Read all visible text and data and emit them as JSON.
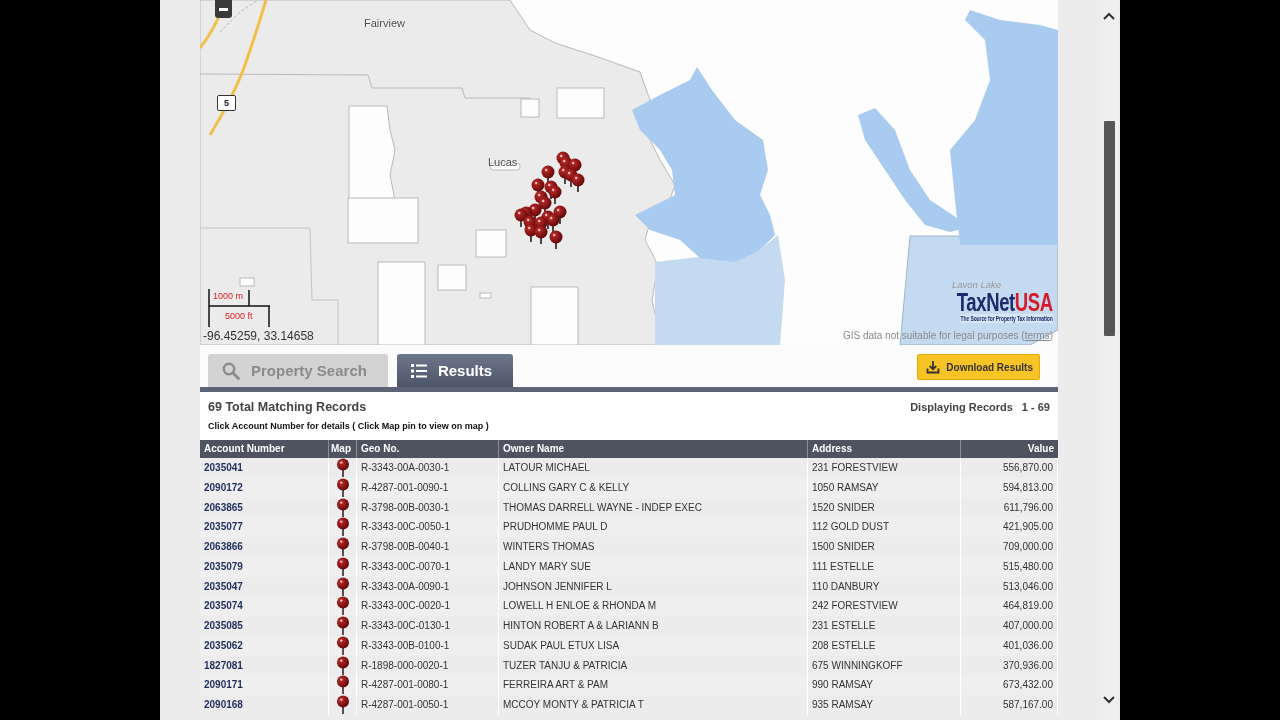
{
  "map": {
    "places": [
      {
        "name": "Fairview"
      },
      {
        "name": "Lucas"
      }
    ],
    "route_shield": "5",
    "lake_label": "Lavon Lake",
    "scale": {
      "metric": "1000 m",
      "imperial": "5000 ft"
    },
    "coordinates": "-96.45259, 33.14658",
    "logo": {
      "wordmark": [
        "TaxNet",
        "USA"
      ],
      "tagline": "The Source for Property Tax Information"
    },
    "disclaimer": {
      "text": "GIS data not suitable for legal purposes (",
      "link": "terms",
      "suffix": ")"
    }
  },
  "tabs": [
    {
      "label": "Property Search",
      "selected": false
    },
    {
      "label": "Results",
      "selected": true
    }
  ],
  "download_button": {
    "label": "Download Results"
  },
  "summary": {
    "total": "69 Total Matching Records",
    "displaying_label": "Displaying Records",
    "range": "1 - 69",
    "hint": "Click Account Number for details ( Click Map pin to view on map )"
  },
  "table": {
    "columns": [
      "Account Number",
      "Map",
      "Geo No.",
      "Owner Name",
      "Address",
      "Value"
    ],
    "rows": [
      {
        "account": "2035041",
        "geo_no": "R-3343-00A-0030-1",
        "owner": "LATOUR MICHAEL",
        "address": "231 FORESTVIEW",
        "value": "556,870.00"
      },
      {
        "account": "2090172",
        "geo_no": "R-4287-001-0090-1",
        "owner": "COLLINS GARY C & KELLY",
        "address": "1050 RAMSAY",
        "value": "594,813.00"
      },
      {
        "account": "2063865",
        "geo_no": "R-3798-00B-0030-1",
        "owner": "THOMAS DARRELL WAYNE - INDEP EXEC",
        "address": "1520 SNIDER",
        "value": "611,796.00"
      },
      {
        "account": "2035077",
        "geo_no": "R-3343-00C-0050-1",
        "owner": "PRUDHOMME PAUL D",
        "address": "112 GOLD DUST",
        "value": "421,905.00"
      },
      {
        "account": "2063866",
        "geo_no": "R-3798-00B-0040-1",
        "owner": "WINTERS THOMAS",
        "address": "1500 SNIDER",
        "value": "709,000.00"
      },
      {
        "account": "2035079",
        "geo_no": "R-3343-00C-0070-1",
        "owner": "LANDY MARY SUE",
        "address": "111 ESTELLE",
        "value": "515,480.00"
      },
      {
        "account": "2035047",
        "geo_no": "R-3343-00A-0090-1",
        "owner": "JOHNSON JENNIFER L",
        "address": "110 DANBURY",
        "value": "513,046.00"
      },
      {
        "account": "2035074",
        "geo_no": "R-3343-00C-0020-1",
        "owner": "LOWELL H ENLOE & RHONDA M",
        "address": "242 FORESTVIEW",
        "value": "464,819.00"
      },
      {
        "account": "2035085",
        "geo_no": "R-3343-00C-0130-1",
        "owner": "HINTON ROBERT A & LARIANN B",
        "address": "231 ESTELLE",
        "value": "407,000.00"
      },
      {
        "account": "2035062",
        "geo_no": "R-3343-00B-0100-1",
        "owner": "SUDAK PAUL ETUX LISA",
        "address": "208 ESTELLE",
        "value": "401,036.00"
      },
      {
        "account": "1827081",
        "geo_no": "R-1898-000-0020-1",
        "owner": "TUZER TANJU & PATRICIA",
        "address": "675 WINNINGKOFF",
        "value": "370,936.00"
      },
      {
        "account": "2090171",
        "geo_no": "R-4287-001-0080-1",
        "owner": "FERREIRA ART & PAM",
        "address": "990 RAMSAY",
        "value": "673,432.00"
      },
      {
        "account": "2090168",
        "geo_no": "R-4287-001-0050-1",
        "owner": "MCCOY MONTY & PATRICIA T",
        "address": "935 RAMSAY",
        "value": "587,167.00"
      }
    ]
  }
}
